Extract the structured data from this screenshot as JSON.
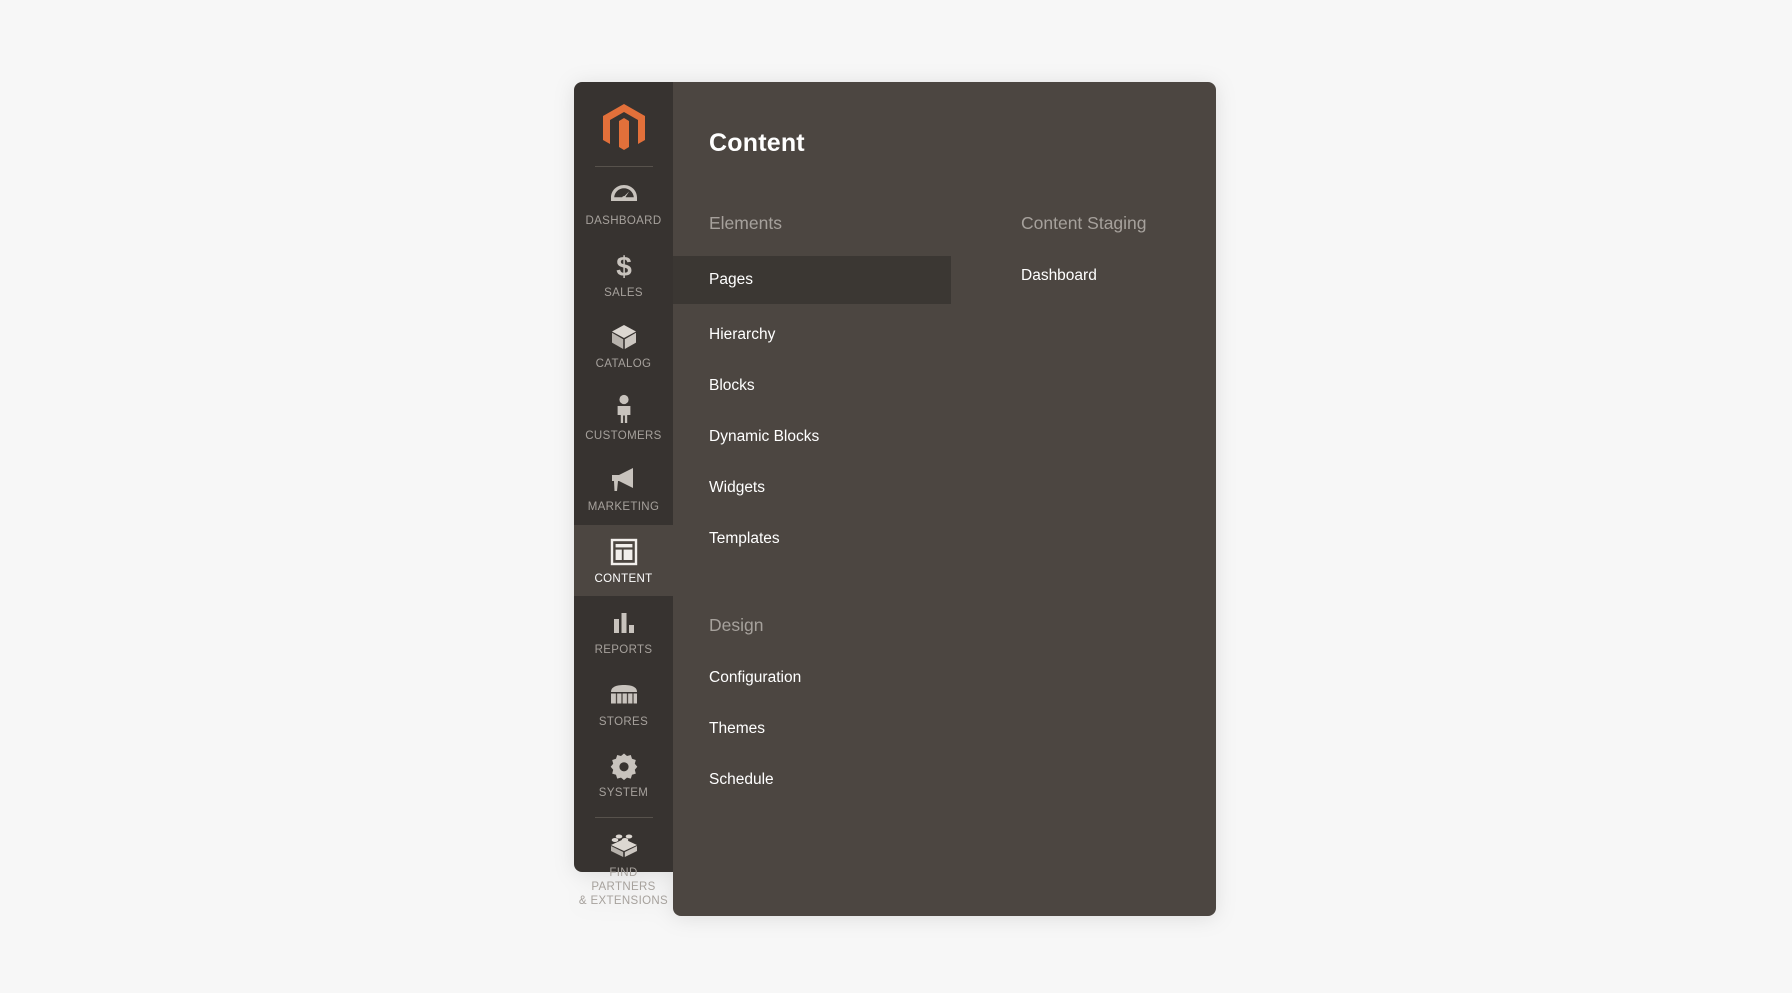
{
  "header": {
    "title": "Content"
  },
  "sidebar": {
    "logo_icon": "magento-logo-icon",
    "logo_color": "#e2703a",
    "items": [
      {
        "label": "DASHBOARD",
        "icon": "gauge-icon",
        "active": false
      },
      {
        "label": "SALES",
        "icon": "dollar-icon",
        "active": false
      },
      {
        "label": "CATALOG",
        "icon": "box-icon",
        "active": false
      },
      {
        "label": "CUSTOMERS",
        "icon": "person-icon",
        "active": false
      },
      {
        "label": "MARKETING",
        "icon": "megaphone-icon",
        "active": false
      },
      {
        "label": "CONTENT",
        "icon": "layout-icon",
        "active": true
      },
      {
        "label": "REPORTS",
        "icon": "bar-chart-icon",
        "active": false
      },
      {
        "label": "STORES",
        "icon": "storefront-icon",
        "active": false
      },
      {
        "label": "SYSTEM",
        "icon": "gear-icon",
        "active": false
      },
      {
        "label": "FIND PARTNERS\n& EXTENSIONS",
        "icon": "lego-brick-icon",
        "active": false
      }
    ]
  },
  "main": {
    "groups": [
      {
        "name": "elements",
        "title": "Elements",
        "items": [
          {
            "label": "Pages",
            "selected": true
          },
          {
            "label": "Hierarchy",
            "selected": false
          },
          {
            "label": "Blocks",
            "selected": false
          },
          {
            "label": "Dynamic Blocks",
            "selected": false
          },
          {
            "label": "Widgets",
            "selected": false
          },
          {
            "label": "Templates",
            "selected": false
          }
        ]
      },
      {
        "name": "design",
        "title": "Design",
        "items": [
          {
            "label": "Configuration",
            "selected": false
          },
          {
            "label": "Themes",
            "selected": false
          },
          {
            "label": "Schedule",
            "selected": false
          }
        ]
      },
      {
        "name": "content_staging",
        "title": "Content Staging",
        "items": [
          {
            "label": "Dashboard",
            "selected": false
          }
        ]
      }
    ]
  },
  "colors": {
    "page_background": "#f7f7f7",
    "sidebar_background": "#373330",
    "panel_background": "#4c4641",
    "selected_item_background": "#3b3733",
    "muted_text": "#a6a19c",
    "primary_text": "#ffffff",
    "accent": "#e2703a"
  }
}
